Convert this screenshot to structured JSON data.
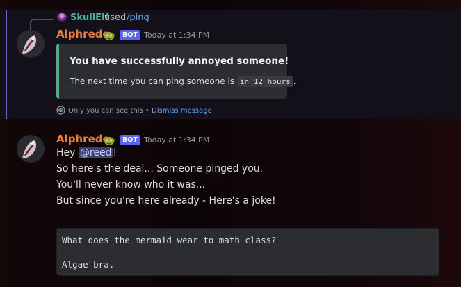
{
  "reply": {
    "username": "SkullElf",
    "used_text": "used",
    "command": "/ping"
  },
  "message1": {
    "username": "Alphredo",
    "bot_tag": "BOT",
    "timestamp": "Today at 1:34 PM",
    "embed": {
      "title": "You have successfully annoyed someone!",
      "description_prefix": "The next time you can ping someone is",
      "description_code": "in 12 hours",
      "description_suffix": ".",
      "accent_color": "#43b581"
    },
    "ephemeral_notice": "Only you can see this",
    "separator": "•",
    "dismiss_link": "Dismiss message"
  },
  "message2": {
    "username": "Alphredo",
    "bot_tag": "BOT",
    "timestamp": "Today at 1:34 PM",
    "greeting_prefix": "Hey",
    "mention": "@reed",
    "greeting_suffix": "!",
    "lines": [
      "So here's the deal... Someone pinged you.",
      "You'll never know who it was...",
      "But since you're here already - Here's a joke!"
    ],
    "code_lines": [
      "What does the mermaid wear to math class?",
      "Algae-bra."
    ]
  },
  "colors": {
    "username": "#e97b3b",
    "bot_tag": "#5865f2",
    "link": "#5aa7e8",
    "reply_username": "#43b593",
    "ephemeral_bar": "#6b5fd8"
  },
  "icons": {
    "app_emoji": "goblin-emoji-icon",
    "eye": "eye-icon"
  }
}
